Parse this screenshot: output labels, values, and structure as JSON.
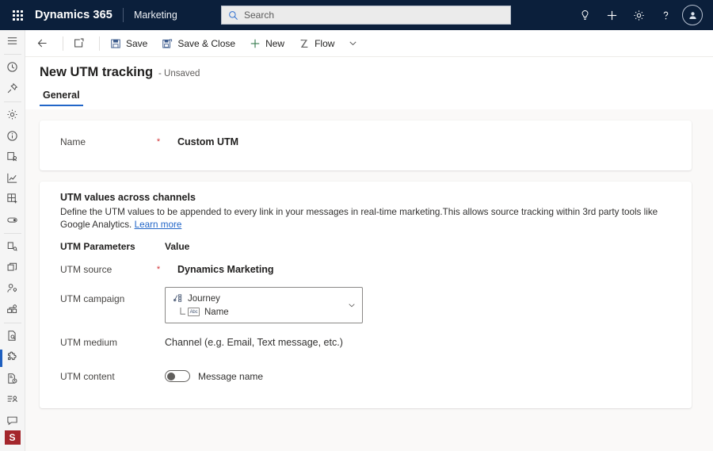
{
  "suitebar": {
    "waffle_label": "app-launcher",
    "brand": "Dynamics 365",
    "app_name": "Marketing",
    "search": {
      "placeholder": "Search",
      "value": ""
    },
    "actions": [
      {
        "name": "lightbulb-icon",
        "label": "Tips"
      },
      {
        "name": "plus-icon",
        "label": "Quick create"
      },
      {
        "name": "gear-icon",
        "label": "Settings"
      },
      {
        "name": "help-icon",
        "label": "Help"
      }
    ],
    "avatar_label": "User account"
  },
  "rail": {
    "items": [
      {
        "name": "hamburger-icon",
        "label": "Expand navigation",
        "selected": false
      },
      {
        "name": "recent-clock-icon",
        "label": "Recent",
        "selected": false
      },
      {
        "name": "pin-icon",
        "label": "Pinned",
        "selected": false
      },
      {
        "name": "gear-icon",
        "label": "Settings",
        "selected": false
      },
      {
        "name": "info-icon",
        "label": "Information",
        "selected": false
      },
      {
        "name": "contact-card-icon",
        "label": "Contacts",
        "selected": false
      },
      {
        "name": "chart-line-icon",
        "label": "Analytics",
        "selected": false
      },
      {
        "name": "grid-add-icon",
        "label": "Segments",
        "selected": false
      },
      {
        "name": "toggle-icon",
        "label": "Consent",
        "selected": false
      },
      {
        "name": "forms-icon",
        "label": "Forms",
        "selected": false
      },
      {
        "name": "pages-icon",
        "label": "Pages",
        "selected": false
      },
      {
        "name": "customer-icon",
        "label": "Customers",
        "selected": false
      },
      {
        "name": "journeys-icon",
        "label": "Journeys",
        "selected": false
      },
      {
        "name": "document-search-icon",
        "label": "Templates",
        "selected": false
      },
      {
        "name": "puzzle-icon",
        "label": "Extensions",
        "selected": true
      },
      {
        "name": "document-clock-icon",
        "label": "Scheduling",
        "selected": false
      },
      {
        "name": "list-person-icon",
        "label": "Lists",
        "selected": false
      },
      {
        "name": "chat-icon",
        "label": "Messages",
        "selected": false
      }
    ],
    "badge": "S"
  },
  "commandbar": {
    "back_label": "Back",
    "popout_label": "Open in new window",
    "save_label": "Save",
    "save_close_label": "Save & Close",
    "new_label": "New",
    "flow_label": "Flow",
    "flow_chevron_label": "More flow options"
  },
  "page": {
    "title": "New UTM tracking",
    "state": "- Unsaved",
    "tabs": [
      {
        "label": "General",
        "active": true
      }
    ]
  },
  "name_card": {
    "label": "Name",
    "required_mark": "*",
    "value": "Custom UTM"
  },
  "utm_card": {
    "section_title": "UTM values across channels",
    "description": "Define the UTM values to be appended to every link in your messages in real-time marketing.This allows source tracking within 3rd party tools like Google Analytics.",
    "learn_more": "Learn more",
    "table_headers": {
      "parameter": "UTM Parameters",
      "value": "Value"
    },
    "rows": {
      "source": {
        "label": "UTM source",
        "required_mark": "*",
        "value": "Dynamics Marketing"
      },
      "campaign": {
        "label": "UTM campaign",
        "token_parent": "Journey",
        "token_parent_icon": "journey-node-icon",
        "token_child": "Name",
        "token_child_icon": "abc-text-icon",
        "chevron": "chevron-down-icon"
      },
      "medium": {
        "label": "UTM medium",
        "value": "Channel (e.g. Email, Text message, etc.)"
      },
      "content": {
        "label": "UTM content",
        "toggle_state": "off",
        "toggle_text": "Message name"
      }
    }
  },
  "colors": {
    "suitebar_bg": "#0b1f3b",
    "accent": "#2266c8",
    "required": "#d13438",
    "badge_bg": "#a4262c",
    "page_bg": "#faf9f8"
  }
}
